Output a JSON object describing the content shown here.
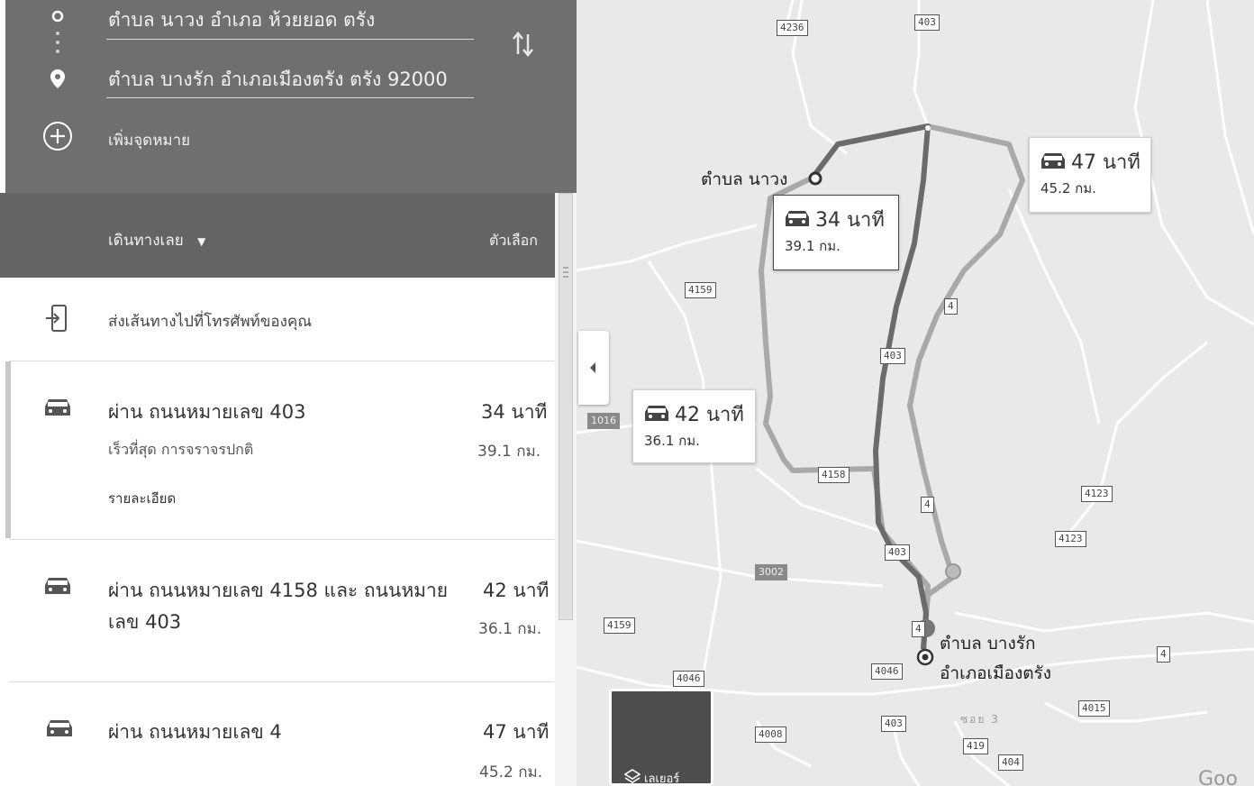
{
  "directions": {
    "origin": "ตำบล นาวง อำเภอ ห้วยยอด ตรัง",
    "destination": "ตำบล บางรัก อำเภอเมืองตรัง ตรัง 92000",
    "add_destination": "เพิ่มจุดหมาย",
    "depart_label": "เดินทางเลย",
    "options_label": "ตัวเลือก"
  },
  "send_to_phone": "ส่งเส้นทางไปที่โทรศัพท์ของคุณ",
  "routes": [
    {
      "via": "ผ่าน ถนนหมายเลข 403",
      "time": "34 นาที",
      "status": "เร็วที่สุด การจราจรปกติ",
      "distance": "39.1 กม.",
      "details": "รายละเอียด"
    },
    {
      "via": "ผ่าน ถนนหมายเลข 4158 และ ถนนหมาย",
      "via2": "เลข 403",
      "time": "42 นาที",
      "distance": "36.1 กม."
    },
    {
      "via": "ผ่าน ถนนหมายเลข 4",
      "time": "47 นาที",
      "distance": "45.2 กม."
    }
  ],
  "map": {
    "origin_label": "ตำบล นาวง",
    "dest_label_line1": "ตำบล บางรัก",
    "dest_label_line2": "อำเภอเมืองตรัง",
    "callouts": [
      {
        "time": "34 นาที",
        "distance": "39.1 กม."
      },
      {
        "time": "42 นาที",
        "distance": "36.1 กม."
      },
      {
        "time": "47 นาที",
        "distance": "45.2 กม."
      }
    ],
    "road_shields": {
      "r4236": "4236",
      "r403a": "403",
      "r4159a": "4159",
      "r4a": "4",
      "r403b": "403",
      "r4158": "4158",
      "r4b": "4",
      "r4123a": "4123",
      "r4123b": "4123",
      "r403c": "403",
      "r4159b": "4159",
      "r4c": "4",
      "r4046a": "4046",
      "r4046b": "4046",
      "r4008": "4008",
      "r403d": "403",
      "r419": "419",
      "r404": "404",
      "r4015": "4015",
      "r4d": "4"
    },
    "grey_roads": {
      "r1016": "1016",
      "r3002": "3002"
    },
    "soi_label": "ซอย 3",
    "layers_label": "เลเยอร์",
    "google": "Goo"
  },
  "colors": {
    "route_active": "#6b6b6b",
    "route_alt": "#a9a9a9",
    "header_bg": "#6f6f6f"
  }
}
